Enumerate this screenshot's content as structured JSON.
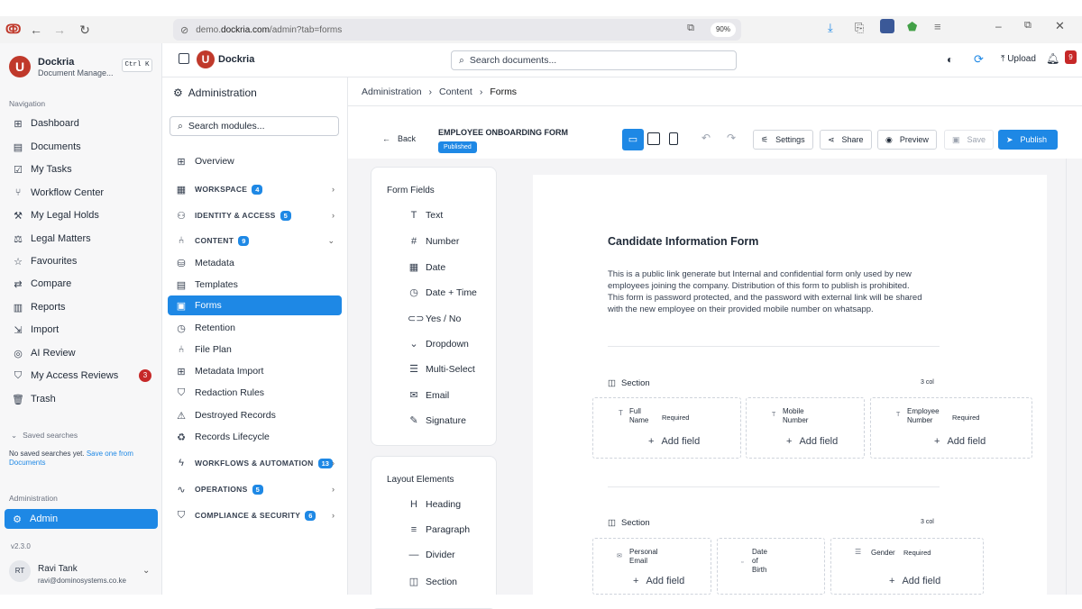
{
  "browser": {
    "url_prefix": "demo.",
    "url_domain": "dockria.com",
    "url_path": "/admin?tab=forms",
    "zoom": "90%"
  },
  "sidebar": {
    "app_name": "Dockria",
    "app_subtitle": "Document Manage...",
    "shortcut": "Ctrl K",
    "nav_heading": "Navigation",
    "items": [
      {
        "label": "Dashboard",
        "icon": "grid-icon"
      },
      {
        "label": "Documents",
        "icon": "document-icon"
      },
      {
        "label": "My Tasks",
        "icon": "checkbox-icon"
      },
      {
        "label": "Workflow Center",
        "icon": "workflow-icon"
      },
      {
        "label": "My Legal Holds",
        "icon": "gavel-icon"
      },
      {
        "label": "Legal Matters",
        "icon": "scale-icon"
      },
      {
        "label": "Favourites",
        "icon": "star-icon"
      },
      {
        "label": "Compare",
        "icon": "compare-icon"
      },
      {
        "label": "Reports",
        "icon": "chart-icon"
      },
      {
        "label": "Import",
        "icon": "import-icon"
      },
      {
        "label": "AI Review",
        "icon": "ai-icon"
      },
      {
        "label": "My Access Reviews",
        "icon": "shield-check-icon",
        "badge": "3"
      },
      {
        "label": "Trash",
        "icon": "trash-icon"
      }
    ],
    "saved_searches_label": "Saved searches",
    "saved_searches_empty": "No saved searches yet.",
    "saved_searches_link": "Save one from",
    "saved_searches_link2": "Documents",
    "admin_heading": "Administration",
    "admin_item": "Admin",
    "version": "v2.3.0",
    "user_initials": "RT",
    "user_name": "Ravi Tank",
    "user_email": "ravi@dominosystems.co.ke"
  },
  "appbar": {
    "brand": "Dockria",
    "search_placeholder": "Search documents...",
    "upload_label": "Upload",
    "notif_count": "9"
  },
  "admin": {
    "title": "Administration",
    "search_placeholder": "Search modules...",
    "overview": "Overview",
    "groups": {
      "workspace": {
        "label": "WORKSPACE",
        "count": "4"
      },
      "identity": {
        "label": "IDENTITY & ACCESS",
        "count": "5"
      },
      "content": {
        "label": "CONTENT",
        "count": "9"
      },
      "workflows": {
        "label": "WORKFLOWS & AUTOMATION",
        "count": "13"
      },
      "operations": {
        "label": "OPERATIONS",
        "count": "5"
      },
      "compliance": {
        "label": "COMPLIANCE & SECURITY",
        "count": "6"
      }
    },
    "content_items": [
      "Metadata",
      "Templates",
      "Forms",
      "Retention",
      "File Plan",
      "Metadata Import",
      "Redaction Rules",
      "Destroyed Records",
      "Records Lifecycle"
    ]
  },
  "breadcrumb": [
    "Administration",
    "Content",
    "Forms"
  ],
  "toolbar": {
    "back": "Back",
    "form_title": "EMPLOYEE ONBOARDING FORM",
    "status": "Published",
    "settings": "Settings",
    "share": "Share",
    "preview": "Preview",
    "save": "Save",
    "publish": "Publish"
  },
  "palette": {
    "fields_title": "Form Fields",
    "fields": [
      "Text",
      "Number",
      "Date",
      "Date + Time",
      "Yes / No",
      "Dropdown",
      "Multi-Select",
      "Email",
      "Signature"
    ],
    "layout_title": "Layout Elements",
    "layout": [
      "Heading",
      "Paragraph",
      "Divider",
      "Section"
    ]
  },
  "form": {
    "heading": "Candidate Information Form",
    "description_lines": [
      "This is a public link generate but Internal and confidential form only used by new",
      "employees joining the company. Distribution of this form to publish is prohibited.",
      "This form is password protected, and the password with external link will be shared",
      "with the new employee on their provided mobile number on whatsapp."
    ],
    "section_label": "Section",
    "cols_label": "3 col",
    "required": "Required",
    "add_field": "Add field",
    "section1": [
      {
        "name1": "Full",
        "name2": "Name",
        "required": true
      },
      {
        "name1": "Mobile",
        "name2": "Number",
        "required": false
      },
      {
        "name1": "Employee",
        "name2": "Number",
        "required": true
      }
    ],
    "section2": [
      {
        "name1": "Personal",
        "name2": "Email"
      },
      {
        "name1": "Date",
        "name2": "of",
        "name3": "Birth"
      },
      {
        "name1": "Gender"
      }
    ]
  },
  "colors": {
    "accent": "#1e88e5",
    "brand": "#c0392b",
    "active_bg": "#1e88e5"
  }
}
